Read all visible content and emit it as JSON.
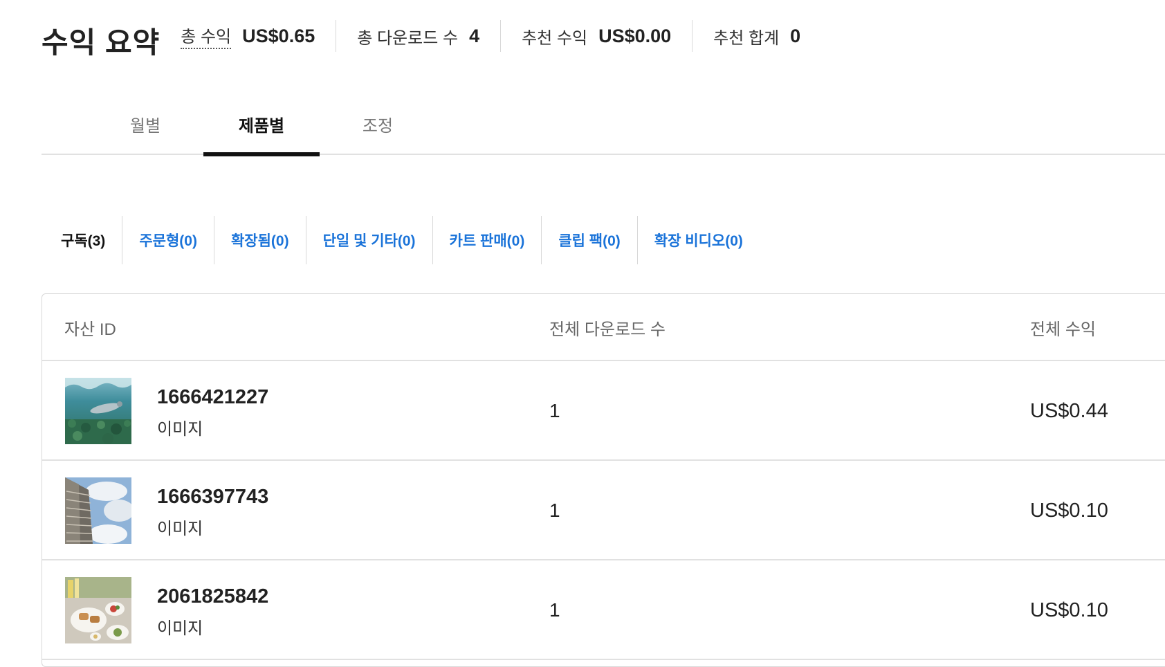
{
  "summary": {
    "title": "수익 요약",
    "stats": [
      {
        "label": "총 수익",
        "value": "US$0.65"
      },
      {
        "label": "총 다운로드 수",
        "value": "4"
      },
      {
        "label": "추천 수익",
        "value": "US$0.00"
      },
      {
        "label": "추천 합계",
        "value": "0"
      }
    ]
  },
  "main_tabs": [
    {
      "label": "월별",
      "active": false
    },
    {
      "label": "제품별",
      "active": true
    },
    {
      "label": "조정",
      "active": false
    }
  ],
  "sub_tabs": [
    {
      "label": "구독(3)",
      "active": true
    },
    {
      "label": "주문형(0)",
      "active": false
    },
    {
      "label": "확장됨(0)",
      "active": false
    },
    {
      "label": "단일 및 기타(0)",
      "active": false
    },
    {
      "label": "카트 판매(0)",
      "active": false
    },
    {
      "label": "클립 팩(0)",
      "active": false
    },
    {
      "label": "확장 비디오(0)",
      "active": false
    }
  ],
  "table": {
    "headers": {
      "asset_id": "자산 ID",
      "downloads": "전체 다운로드 수",
      "revenue": "전체 수익"
    },
    "rows": [
      {
        "asset_id": "1666421227",
        "type": "이미지",
        "downloads": "1",
        "revenue": "US$0.44",
        "thumb": "underwater-seal-icon"
      },
      {
        "asset_id": "1666397743",
        "type": "이미지",
        "downloads": "1",
        "revenue": "US$0.10",
        "thumb": "skyscraper-sky-icon"
      },
      {
        "asset_id": "2061825842",
        "type": "이미지",
        "downloads": "1",
        "revenue": "US$0.10",
        "thumb": "food-plates-icon"
      }
    ]
  },
  "colors": {
    "link": "#1a73d9",
    "text": "#222222",
    "muted": "#666666",
    "border": "#e1e1e1"
  }
}
